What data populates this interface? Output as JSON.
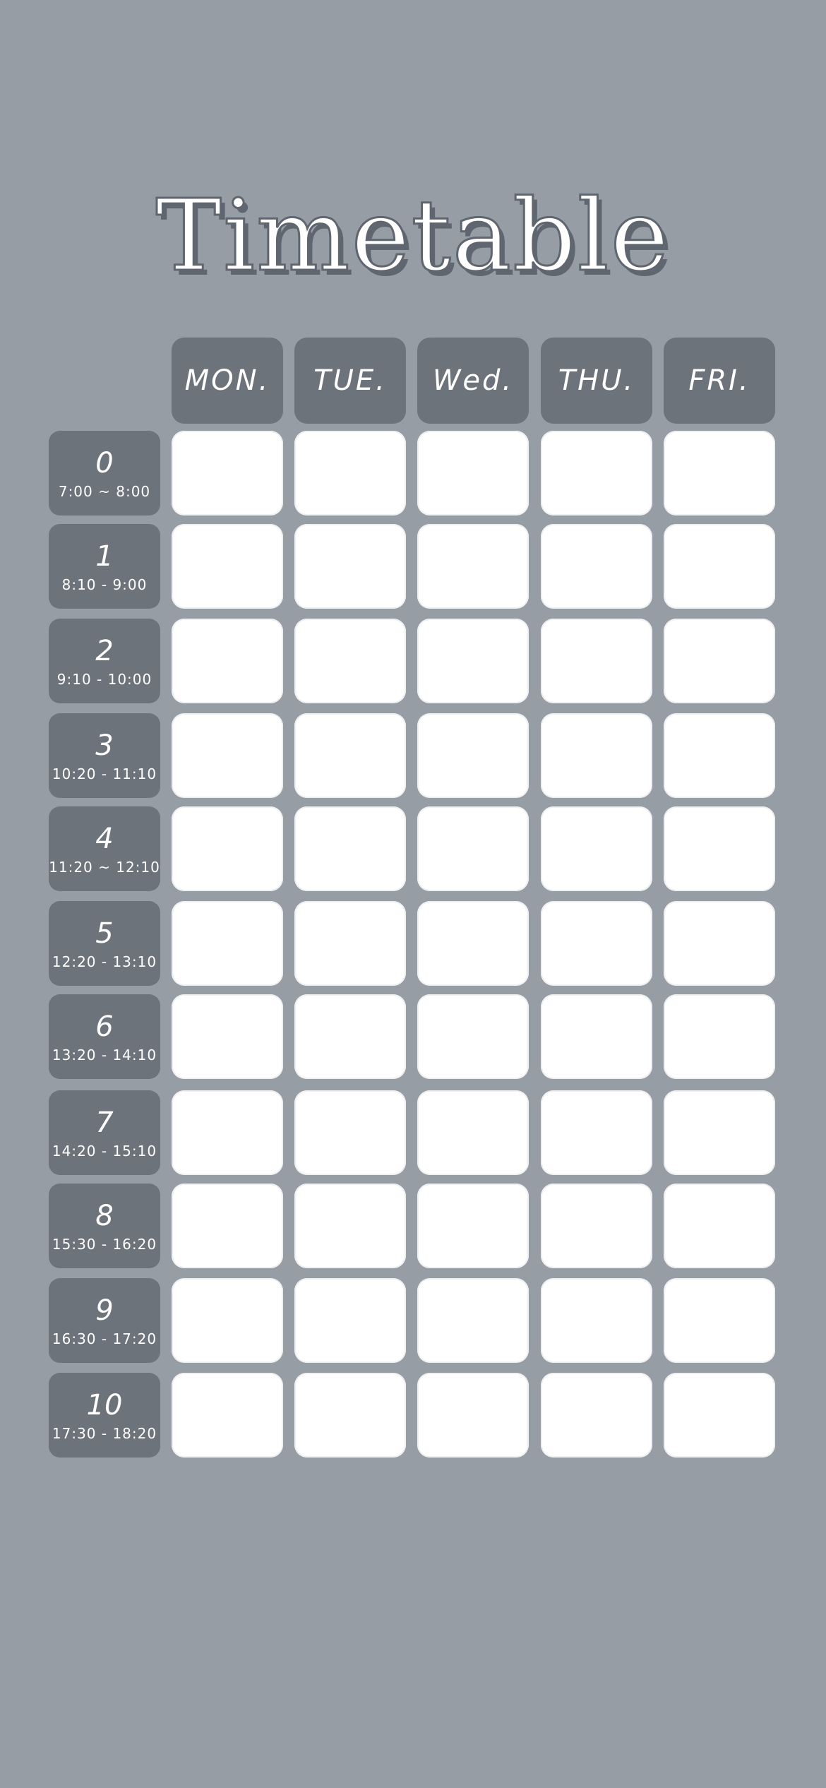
{
  "title": "Timetable",
  "days": [
    "MON.",
    "TUE.",
    "Wed.",
    "THU.",
    "FRI."
  ],
  "periods": [
    {
      "num": "0",
      "time": "7:00 ~ 8:00"
    },
    {
      "num": "1",
      "time": "8:10 - 9:00"
    },
    {
      "num": "2",
      "time": "9:10 - 10:00"
    },
    {
      "num": "3",
      "time": "10:20 - 11:10"
    },
    {
      "num": "4",
      "time": "11:20 ~ 12:10"
    },
    {
      "num": "5",
      "time": "12:20 - 13:10"
    },
    {
      "num": "6",
      "time": "13:20 - 14:10"
    },
    {
      "num": "7",
      "time": "14:20 - 15:10"
    },
    {
      "num": "8",
      "time": "15:30 - 16:20"
    },
    {
      "num": "9",
      "time": "16:30 - 17:20"
    },
    {
      "num": "10",
      "time": "17:30 - 18:20"
    }
  ],
  "colors": {
    "background": "#979da5",
    "header_bg": "#6d737b",
    "cell_bg": "#ffffff",
    "text": "#ffffff"
  }
}
